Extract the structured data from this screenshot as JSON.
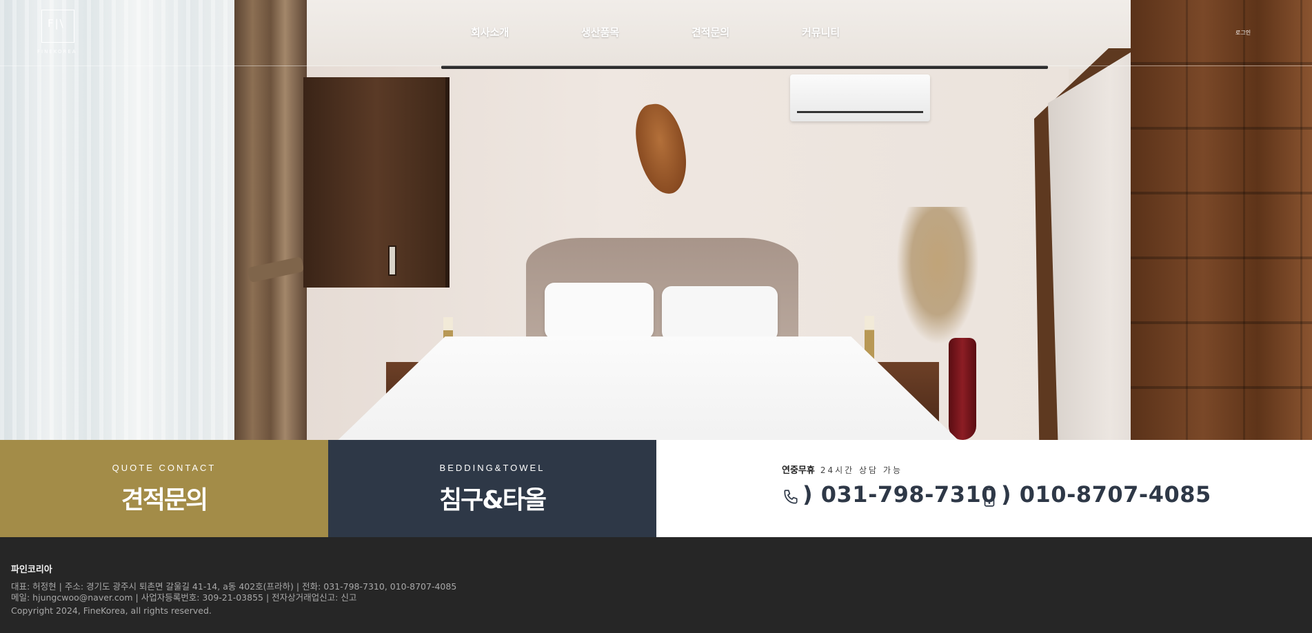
{
  "header": {
    "logo_mark": "F|\\",
    "logo_text": "FINEKOREA",
    "nav": [
      "회사소개",
      "생산품목",
      "견적문의",
      "커뮤니티"
    ],
    "login": "로그인"
  },
  "hero": {
    "image": "bedroom-hero-image"
  },
  "banner": {
    "quote": {
      "eyebrow": "QUOTE CONTACT",
      "title": "견적문의",
      "color": "#a38c48"
    },
    "bedding": {
      "eyebrow": "BEDDING&TOWEL",
      "title": "침구&타올",
      "color": "#2e3847"
    },
    "contact": {
      "hours_label": "연중무휴",
      "hours_sub": "24시간 상담 가능",
      "phone": ") 031-798-7310",
      "mobile": ") 010-8707-4085",
      "phone_icon": "phone-icon",
      "mobile_icon": "mobile-icon"
    }
  },
  "footer": {
    "company": "파인코리아",
    "line1": "대표: 허정현 | 주소: 경기도 광주시 퇴촌면 갈울길 41-14, a동 402호(프라하) | 전화: 031-798-7310, 010-8707-4085",
    "line2": "메일: hjungcwoo@naver.com | 사업자등록번호: 309-21-03855 | 전자상거래업신고: 신고",
    "copyright": "Copyright 2024, FineKorea, all rights reserved."
  }
}
